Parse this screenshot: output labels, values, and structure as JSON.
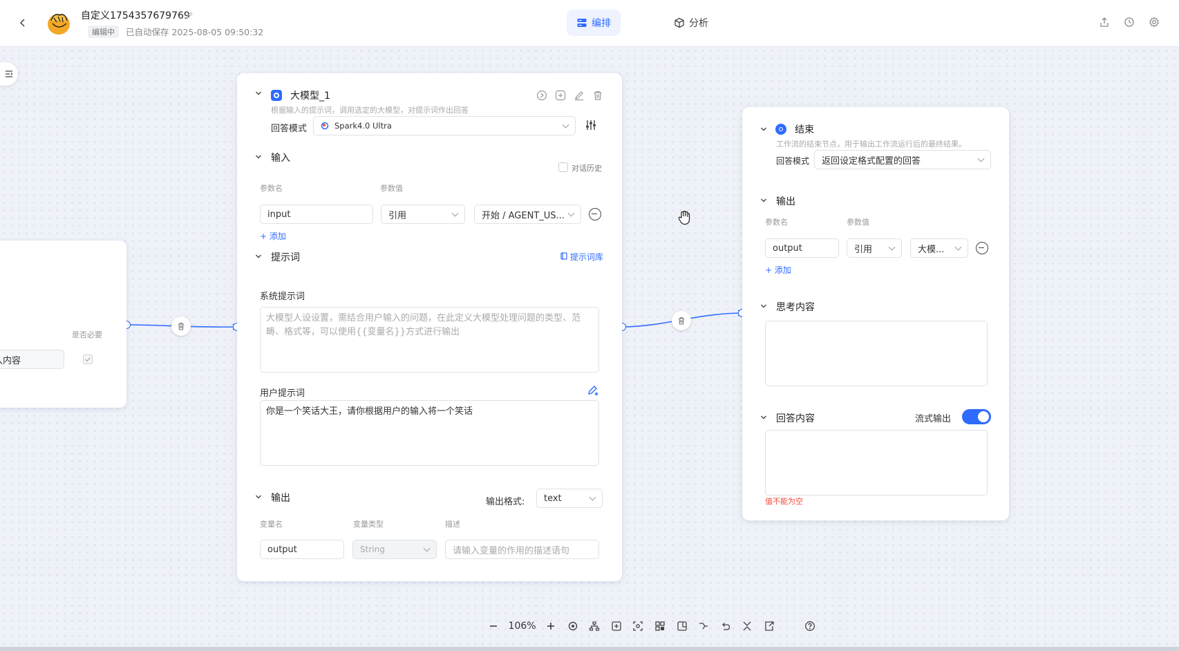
{
  "header": {
    "title": "自定义1754357679769",
    "status": "编辑中",
    "autosave": "已自动保存 2025-08-05 09:50:32",
    "tabs": [
      {
        "label": "编排",
        "active": true
      },
      {
        "label": "分析",
        "active": false
      }
    ],
    "icons": [
      "share-icon",
      "history-icon",
      "settings-icon"
    ]
  },
  "start_node": {
    "required_label": "是否必要",
    "field_value": "入内容"
  },
  "llm_node": {
    "title": "大模型_1",
    "description": "根据输入的提示词，调用选定的大模型，对提示词作出回答",
    "mode_label": "回答模式",
    "model": "Spark4.0 Ultra",
    "input_section": "输入",
    "history_label": "对话历史",
    "param_name_label": "参数名",
    "param_value_label": "参数值",
    "input_name": "input",
    "input_ref": "引用",
    "input_source": "开始 / AGENT_US...",
    "add_label": "添加",
    "prompt_section": "提示词",
    "prompt_library": "提示词库",
    "system_prompt_label": "系统提示词",
    "system_prompt_placeholder": "大模型人设设置，需结合用户输入的问题，在此定义大模型处理问题的类型、范畴、格式等，可以使用{{变量名}}方式进行输出",
    "user_prompt_label": "用户提示词",
    "user_prompt_value": "你是一个笑话大王，请你根据用户的输入将一个笑话",
    "output_section": "输出",
    "output_format_label": "输出格式:",
    "output_format": "text",
    "var_name_label": "变量名",
    "var_type_label": "变量类型",
    "desc_label": "描述",
    "output_name": "output",
    "output_type": "String",
    "desc_placeholder": "请输入变量的作用的描述语句"
  },
  "end_node": {
    "title": "结束",
    "description": "工作流的结束节点，用于输出工作流运行后的最终结果。",
    "mode_label": "回答模式",
    "mode_value": "返回设定格式配置的回答",
    "output_section": "输出",
    "param_name_label": "参数名",
    "param_value_label": "参数值",
    "output_name": "output",
    "output_ref": "引用",
    "output_source": "大模...",
    "add_label": "添加",
    "thinking_section": "思考内容",
    "answer_section": "回答内容",
    "stream_label": "流式输出",
    "stream_on": true,
    "error_text": "值不能为空"
  },
  "toolbar": {
    "zoom": "106%"
  },
  "colors": {
    "accent": "#2f6bff",
    "error": "#f5483b"
  }
}
